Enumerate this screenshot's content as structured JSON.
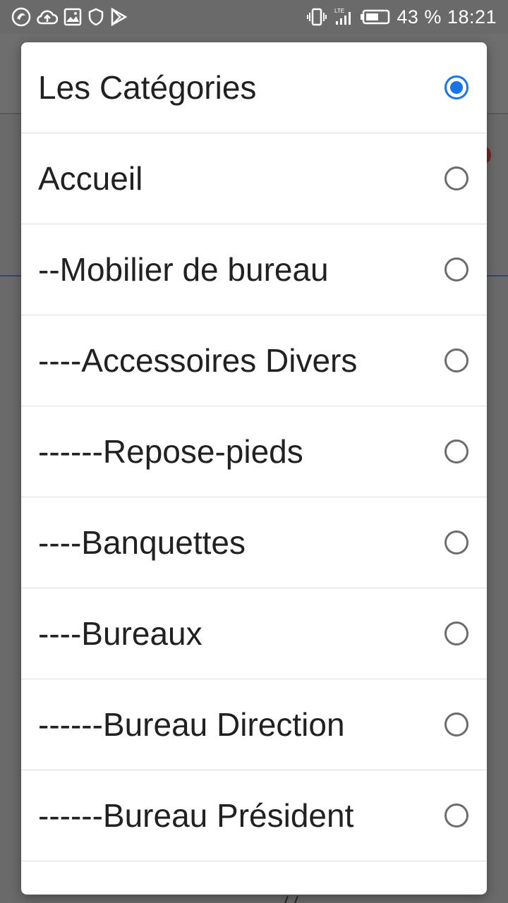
{
  "status_bar": {
    "battery_percent": "43 %",
    "time": "18:21",
    "network_label": "LTE",
    "left_icons": [
      "app-swirl-icon",
      "cloud-upload-icon",
      "image-icon",
      "shield-icon",
      "play-store-icon"
    ],
    "right_icons": [
      "vibrate-icon",
      "signal-icon",
      "battery-icon"
    ]
  },
  "dialog": {
    "options": [
      {
        "label": "Les Catégories",
        "selected": true
      },
      {
        "label": "Accueil",
        "selected": false
      },
      {
        "label": "--Mobilier de bureau",
        "selected": false
      },
      {
        "label": "----Accessoires Divers",
        "selected": false
      },
      {
        "label": "------Repose-pieds",
        "selected": false
      },
      {
        "label": "----Banquettes",
        "selected": false
      },
      {
        "label": "----Bureaux",
        "selected": false
      },
      {
        "label": "------Bureau Direction",
        "selected": false
      },
      {
        "label": "------Bureau Président",
        "selected": false
      }
    ]
  },
  "colors": {
    "accent": "#1a73e8",
    "scrim": "#6a6a6a",
    "dialog_bg": "#ffffff"
  }
}
